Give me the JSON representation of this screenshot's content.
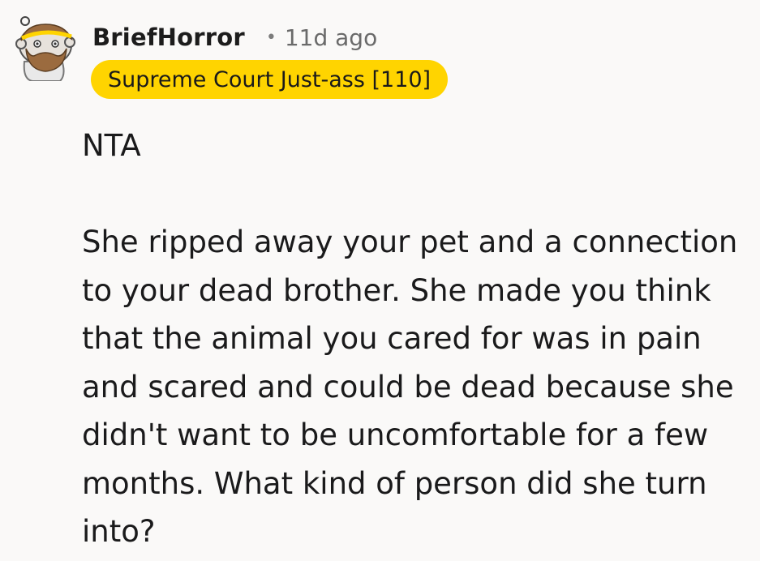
{
  "comment": {
    "author": "BriefHorror",
    "separator": "•",
    "timestamp": "11d ago",
    "flair": "Supreme Court Just-ass [110]",
    "avatar_icon": "snoo-avatar-with-halo-and-beard",
    "body": [
      "NTA",
      "She ripped away your pet and a connection to your dead brother. She made you think that the animal you cared for was in pain and scared and could be dead because she didn't want to be uncomfortable for a few months. What kind of person did she turn into?"
    ]
  },
  "colors": {
    "background": "#faf9f8",
    "flair_background": "#ffd400",
    "text": "#1a1a1b",
    "meta": "#6a6a6a"
  }
}
